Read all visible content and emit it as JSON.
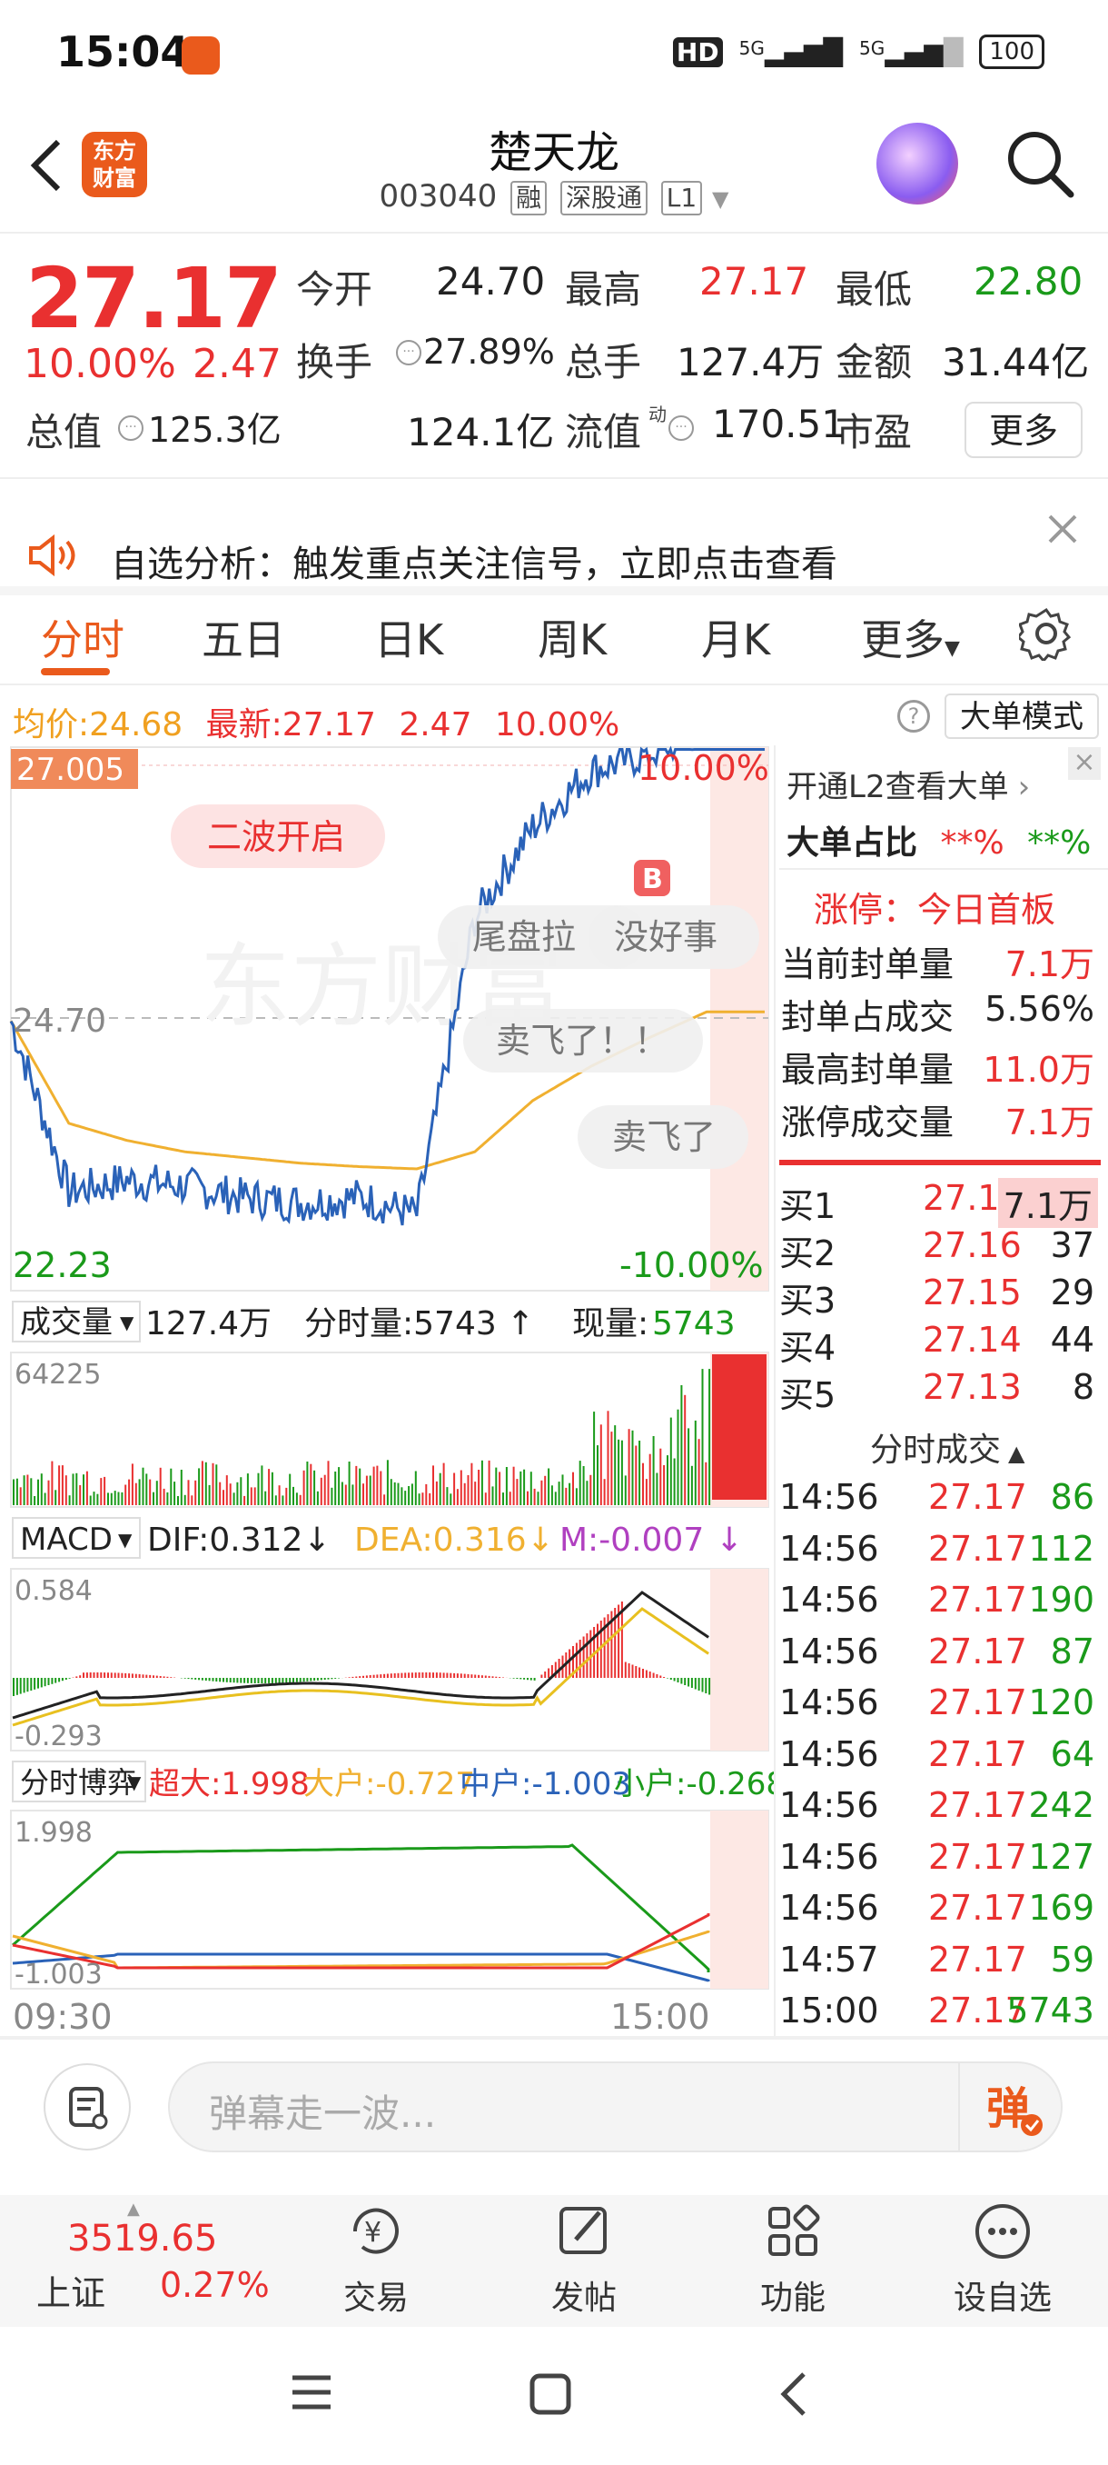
{
  "status_bar": {
    "time": "15:04",
    "net1": "5G",
    "net2": "5G",
    "hd": "HD",
    "battery": "100"
  },
  "header": {
    "stock_name": "楚天龙",
    "stock_code": "003040",
    "tags": [
      "融",
      "深股通",
      "L1"
    ],
    "logo_text": "东方财富"
  },
  "quote": {
    "price": "27.17",
    "change_pct": "10.00%",
    "change_amt": "2.47",
    "fields": [
      {
        "label": "今开",
        "value": "24.70",
        "color": "#222222"
      },
      {
        "label": "最高",
        "value": "27.17",
        "color": "#e93030"
      },
      {
        "label": "最低",
        "value": "22.80",
        "color": "#1a9a1a"
      },
      {
        "label": "换手",
        "value": "27.89%",
        "color": "#222222"
      },
      {
        "label": "总手",
        "value": "127.4万",
        "color": "#222222"
      },
      {
        "label": "金额",
        "value": "31.44亿",
        "color": "#222222"
      },
      {
        "label": "总值",
        "value": "125.3亿",
        "color": "#222222"
      },
      {
        "label": "流值",
        "value": "124.1亿",
        "color": "#222222"
      },
      {
        "label": "市盈",
        "value": "170.51",
        "color": "#222222"
      }
    ],
    "pe_superscript": "动",
    "more_label": "更多"
  },
  "notice": {
    "text": "自选分析：触发重点关注信号，立即点击查看"
  },
  "tabs": [
    "分时",
    "五日",
    "日K",
    "周K",
    "月K",
    "更多"
  ],
  "chart_info": {
    "avg_label": "均价:",
    "avg_value": "24.68",
    "latest_label": "最新:",
    "latest_value": "27.17",
    "latest_change": "2.47",
    "latest_pct": "10.00%",
    "big_order_label": "大单模式"
  },
  "price_chart": {
    "top_label": "27.005",
    "top_pct": "10.00%",
    "mid_label": "24.70",
    "bottom_label": "22.23",
    "bottom_pct": "-10.00%",
    "watermark": "东方财富",
    "danmaku": [
      "二波开启",
      "尾盘拉",
      "没好事",
      "卖飞了！！",
      "卖飞了"
    ],
    "badge": "B"
  },
  "volume_chart": {
    "label": "成交量",
    "total": "127.4万",
    "minute_label": "分时量:5743",
    "now_label": "现量:",
    "now_value": "5743",
    "max_label": "64225"
  },
  "macd": {
    "label": "MACD",
    "dif": "DIF:0.312",
    "dea": "DEA:0.316",
    "m": "M:-0.007",
    "top": "0.584",
    "bottom": "-0.293"
  },
  "flow": {
    "label": "分时博弈",
    "super": "超大:1.998",
    "large": "大户:-0.727",
    "mid": "中户:-1.003",
    "small": "小户:-0.268",
    "top": "1.998",
    "bottom": "-1.003"
  },
  "time_axis": {
    "start": "09:30",
    "end": "15:00"
  },
  "chart_data": [
    {
      "type": "line",
      "title": "",
      "x": [
        "09:30",
        "10:00",
        "10:30",
        "11:00",
        "11:30",
        "13:30",
        "14:00",
        "14:20",
        "14:30",
        "14:40",
        "14:45",
        "14:50",
        "14:56",
        "15:00"
      ],
      "series": [
        {
          "name": "",
          "values": [
            24.6,
            23.1,
            23.2,
            23.15,
            23.05,
            23.0,
            23.05,
            22.9,
            25.5,
            26.3,
            26.8,
            26.95,
            27.17,
            27.17
          ]
        },
        {
          "name": "均价",
          "values": [
            24.6,
            23.7,
            23.55,
            23.45,
            23.4,
            23.35,
            23.32,
            23.3,
            23.45,
            23.9,
            24.2,
            24.45,
            24.68,
            24.68
          ]
        }
      ],
      "ylim": [
        22.23,
        27.005
      ],
      "reference": 24.7
    }
  ],
  "right_panel": {
    "l2_banner": "开通L2查看大单",
    "big_ratio_label": "大单占比",
    "big_ratio_values": [
      "**%",
      "**%"
    ],
    "limit_title": "涨停：今日首板",
    "limit_rows": [
      {
        "label": "当前封单量",
        "value": "7.1万"
      },
      {
        "label": "封单占成交",
        "value": "5.56%"
      },
      {
        "label": "最高封单量",
        "value": "11.0万"
      },
      {
        "label": "涨停成交量",
        "value": "7.1万"
      }
    ],
    "bids": [
      {
        "label": "买1",
        "price": "27.17",
        "vol": "7.1万"
      },
      {
        "label": "买2",
        "price": "27.16",
        "vol": "37"
      },
      {
        "label": "买3",
        "price": "27.15",
        "vol": "29"
      },
      {
        "label": "买4",
        "price": "27.14",
        "vol": "44"
      },
      {
        "label": "买5",
        "price": "27.13",
        "vol": "8"
      }
    ],
    "trades_title": "分时成交",
    "trades": [
      {
        "time": "14:56",
        "price": "27.17",
        "vol": "86"
      },
      {
        "time": "14:56",
        "price": "27.17",
        "vol": "112"
      },
      {
        "time": "14:56",
        "price": "27.17",
        "vol": "190"
      },
      {
        "time": "14:56",
        "price": "27.17",
        "vol": "87"
      },
      {
        "time": "14:56",
        "price": "27.17",
        "vol": "120"
      },
      {
        "time": "14:56",
        "price": "27.17",
        "vol": "64"
      },
      {
        "time": "14:56",
        "price": "27.17",
        "vol": "242"
      },
      {
        "time": "14:56",
        "price": "27.17",
        "vol": "127"
      },
      {
        "time": "14:56",
        "price": "27.17",
        "vol": "169"
      },
      {
        "time": "14:57",
        "price": "27.17",
        "vol": "59"
      },
      {
        "time": "15:00",
        "price": "27.17",
        "vol": "5743"
      }
    ]
  },
  "comment": {
    "placeholder": "弹幕走一波..."
  },
  "bottom_nav": {
    "index_value": "3519.65",
    "index_name": "上证",
    "index_pct": "0.27%",
    "items": [
      {
        "label": "交易"
      },
      {
        "label": "发帖"
      },
      {
        "label": "功能"
      },
      {
        "label": "设自选"
      }
    ]
  }
}
